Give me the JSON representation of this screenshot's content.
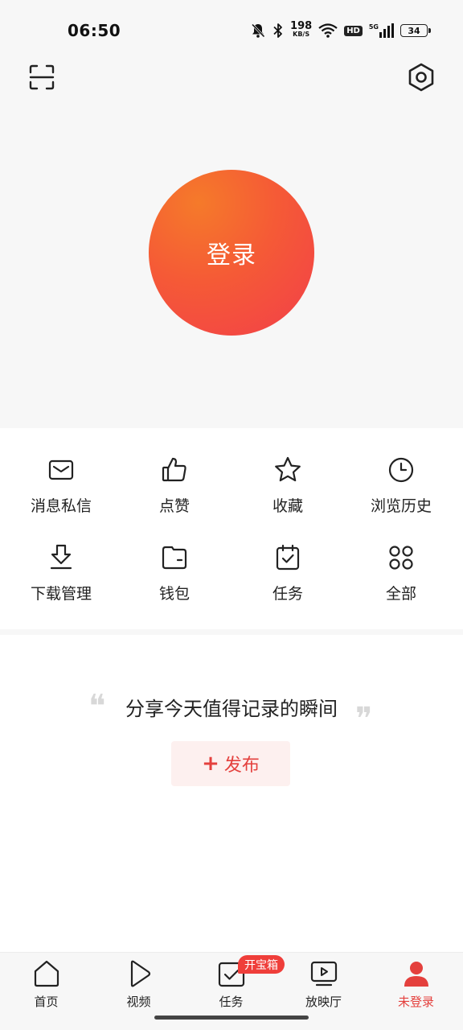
{
  "status_bar": {
    "time": "06:50",
    "net_speed": "198",
    "net_unit": "KB/S",
    "hd": "HD",
    "signal_gen": "5G",
    "battery": "34"
  },
  "header": {
    "scan_icon": "scan-icon",
    "settings_icon": "settings-hexagon-icon"
  },
  "login": {
    "label": "登录",
    "gradient_start": "#f57a2a",
    "gradient_end": "#f23f4a"
  },
  "menu": {
    "items": [
      {
        "label": "消息私信",
        "icon": "mail-icon"
      },
      {
        "label": "点赞",
        "icon": "thumbs-up-icon"
      },
      {
        "label": "收藏",
        "icon": "star-icon"
      },
      {
        "label": "浏览历史",
        "icon": "clock-icon"
      },
      {
        "label": "下载管理",
        "icon": "download-icon"
      },
      {
        "label": "钱包",
        "icon": "wallet-icon"
      },
      {
        "label": "任务",
        "icon": "calendar-check-icon"
      },
      {
        "label": "全部",
        "icon": "grid-circles-icon"
      }
    ]
  },
  "share": {
    "prompt": "分享今天值得记录的瞬间",
    "quote_open": "❝",
    "quote_close": "❞",
    "publish_plus": "+",
    "publish_label": "发布",
    "accent": "#e4403d"
  },
  "tabs": {
    "items": [
      {
        "label": "首页",
        "icon": "home-icon"
      },
      {
        "label": "视频",
        "icon": "play-icon"
      },
      {
        "label": "任务",
        "icon": "task-check-icon"
      },
      {
        "label": "放映厅",
        "icon": "tv-play-icon"
      },
      {
        "label": "未登录",
        "icon": "user-icon"
      }
    ],
    "badge": "开宝箱",
    "active_index": 4
  }
}
